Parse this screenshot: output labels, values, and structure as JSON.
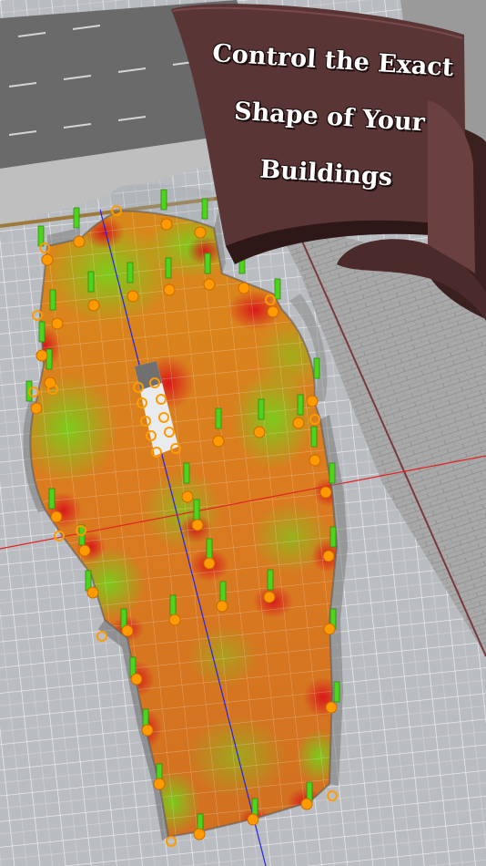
{
  "headline": {
    "line1": "Control the Exact",
    "line2": "Shape of Your",
    "line3": "Buildings"
  },
  "colors": {
    "banner": "#5a3535",
    "banner_dark": "#3b2020",
    "floor_hot": "#d21a1a",
    "floor_mid": "#e0821a",
    "floor_cool": "#6cc21e",
    "handle": "#ff9a00",
    "pillar": "#4fd31c",
    "axis_red": "#e22222",
    "axis_blue": "#2222ee",
    "grid_bg": "#b9bcc1",
    "road": "#6e6e6e"
  },
  "icons": [
    "vertex-handle-icon",
    "support-pillar-icon",
    "open-vertex-icon"
  ]
}
